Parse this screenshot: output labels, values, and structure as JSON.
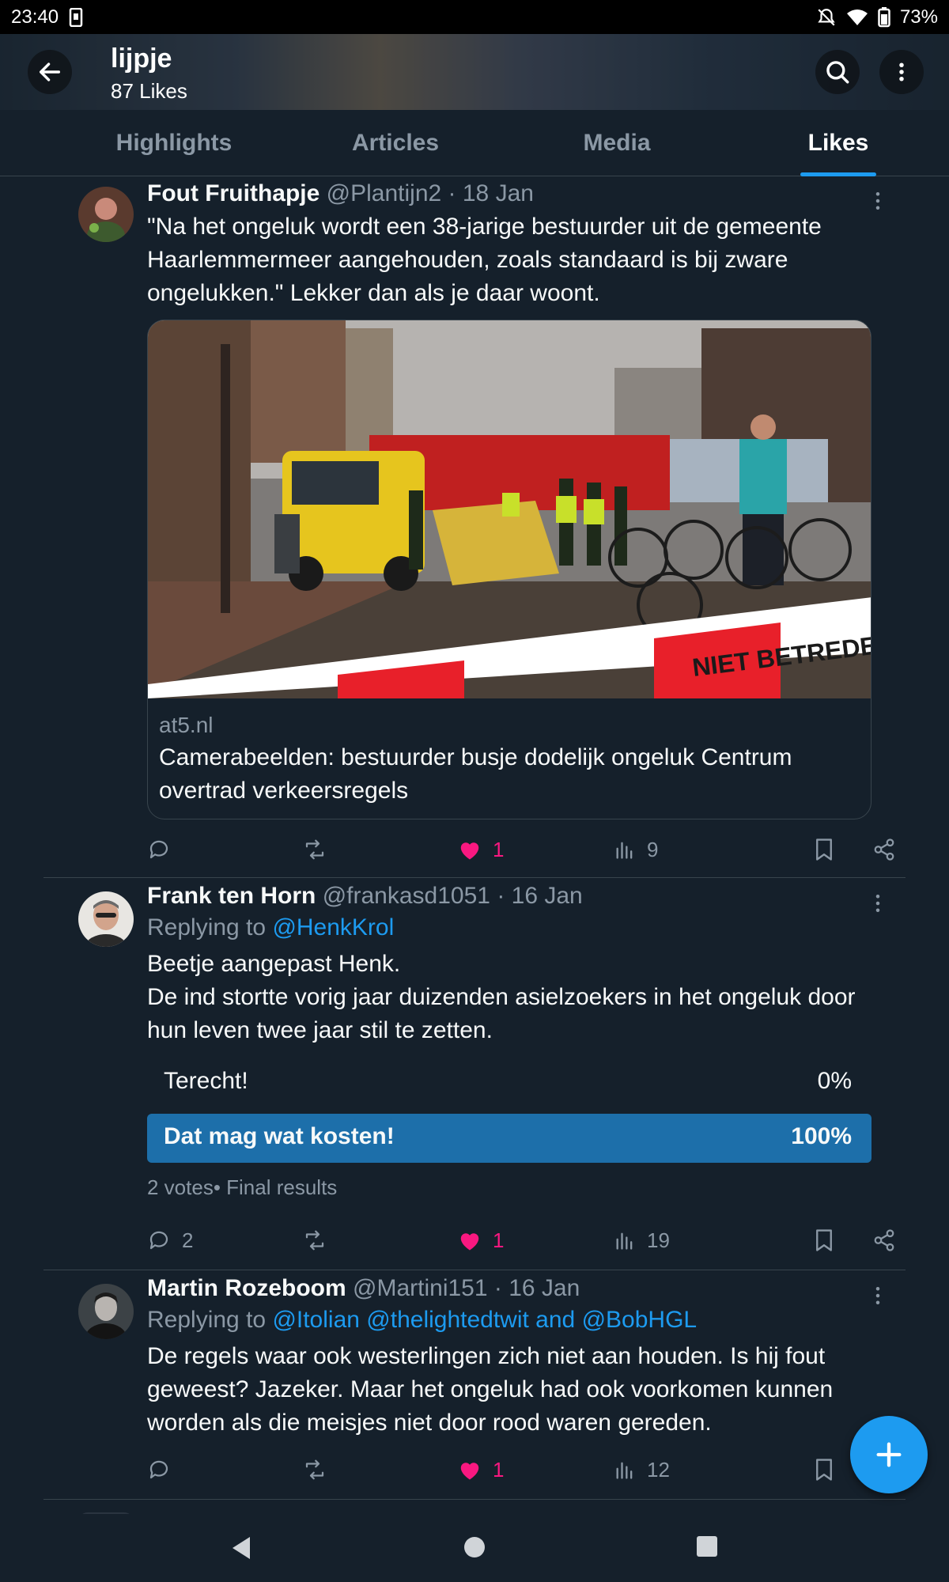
{
  "status_bar": {
    "time": "23:40",
    "battery": "73%"
  },
  "profile": {
    "name": "lijpje",
    "likes_count": "87 Likes"
  },
  "tabs": [
    {
      "label": "Highlights",
      "active": false
    },
    {
      "label": "Articles",
      "active": false
    },
    {
      "label": "Media",
      "active": false
    },
    {
      "label": "Likes",
      "active": true
    }
  ],
  "posts": [
    {
      "author": "Fout Fruithapje",
      "handle": "@Plantijn2",
      "date": "· 18 Jan",
      "text": "\"Na het ongeluk wordt een 38-jarige bestuurder uit de gemeente Haarlemmermeer aangehouden, zoals standaard is bij zware ongelukken.\" Lekker dan als je daar woont.",
      "card": {
        "domain": "at5.nl",
        "title": "Camerabeelden: bestuurder busje dodelijk ongeluk Centrum overtrad verkeersregels",
        "tape_text": "NIET BETREDEN"
      },
      "stats": {
        "replies": "",
        "reposts": "",
        "likes": "1",
        "views": "9"
      }
    },
    {
      "author": "Frank ten Horn",
      "handle": "@frankasd1051",
      "date": "· 16 Jan",
      "replying_prefix": "Replying to ",
      "replying_to": "@HenkKrol",
      "text_line1": "Beetje aangepast Henk.",
      "text_line2": "De ind stortte vorig jaar duizenden asielzoekers in het ongeluk door hun leven twee jaar stil te zetten.",
      "poll": {
        "options": [
          {
            "label": "Terecht!",
            "percent": "0%"
          },
          {
            "label": "Dat mag wat kosten!",
            "percent": "100%"
          }
        ],
        "summary": "2 votes• Final results"
      },
      "stats": {
        "replies": "2",
        "reposts": "",
        "likes": "1",
        "views": "19"
      }
    },
    {
      "author": "Martin Rozeboom",
      "handle": "@Martini151",
      "date": "· 16 Jan",
      "replying_prefix": "Replying to ",
      "replying_to": "@Itolian @thelightedtwit and @BobHGL",
      "text": "De regels waar ook westerlingen zich niet aan houden. Is hij fout geweest? Jazeker. Maar het ongeluk had ook voorkomen kunnen worden als die meisjes niet door rood waren gereden.",
      "stats": {
        "replies": "",
        "reposts": "",
        "likes": "1",
        "views": "12"
      }
    }
  ],
  "colors": {
    "background": "#15202b",
    "accent": "#1d9bf0",
    "like": "#f91880",
    "muted": "#8b98a5",
    "poll_winner": "#1d6faa"
  },
  "icons": [
    "back-arrow-icon",
    "search-icon",
    "more-vertical-icon",
    "reply-icon",
    "repost-icon",
    "heart-icon",
    "views-icon",
    "bookmark-icon",
    "share-icon",
    "plus-icon"
  ]
}
